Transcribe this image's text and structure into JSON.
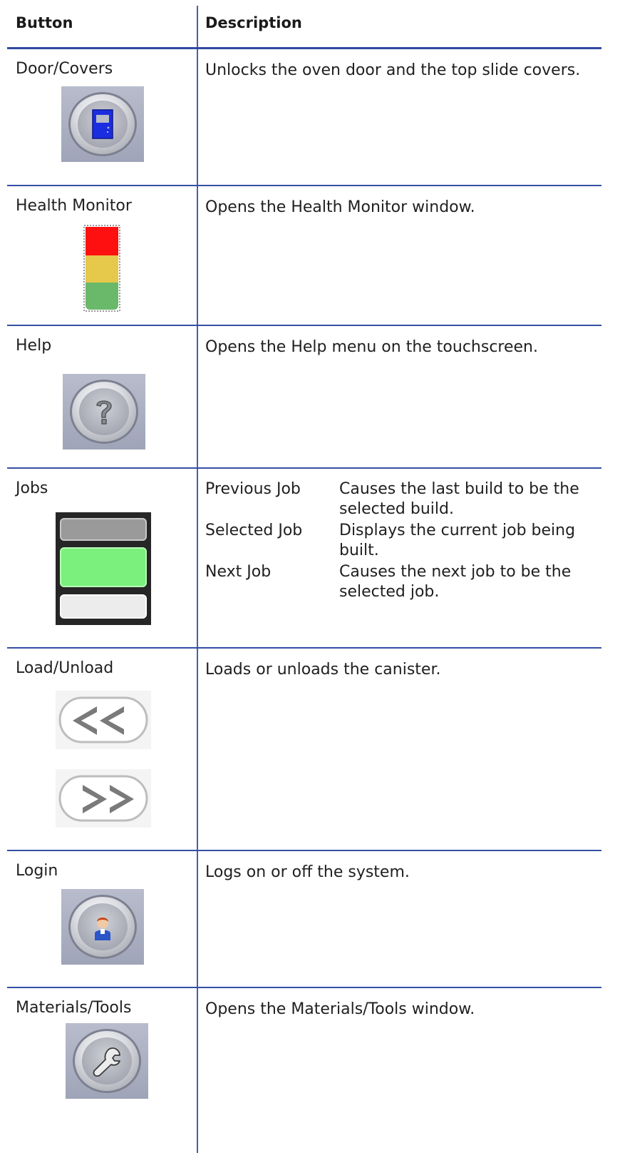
{
  "header": {
    "col_button": "Button",
    "col_description": "Description"
  },
  "rows": [
    {
      "name": "Door/Covers",
      "description": "Unlocks the oven door and the top slide covers.",
      "icon": "door-icon"
    },
    {
      "name": "Health Monitor",
      "description": "Opens the Health Monitor window.",
      "icon": "health-monitor-icon"
    },
    {
      "name": "Help",
      "description": "Opens the Help menu on the touchscreen.",
      "icon": "help-icon"
    },
    {
      "name": "Jobs",
      "icon": "jobs-icon",
      "jobs": [
        {
          "label": "Previous Job",
          "text": "Causes the last build to be the selected build."
        },
        {
          "label": "Selected Job",
          "text": "Displays the current job being built."
        },
        {
          "label": "Next Job",
          "text": "Causes the next job to be the selected job."
        }
      ]
    },
    {
      "name": "Load/Unload",
      "description": "Loads or unloads the canister.",
      "icon": "load-unload-icon"
    },
    {
      "name": "Login",
      "description": "Logs on or off the system.",
      "icon": "login-icon"
    },
    {
      "name": "Materials/Tools",
      "description": "Opens the Materials/Tools window.",
      "icon": "wrench-icon"
    }
  ],
  "colors": {
    "rule": "#3450a4",
    "door_blue": "#1a2de0",
    "health_red": "#ff1010",
    "health_yellow": "#e6c84a",
    "health_green": "#6ab86a",
    "jobs_green": "#7cf07c"
  }
}
